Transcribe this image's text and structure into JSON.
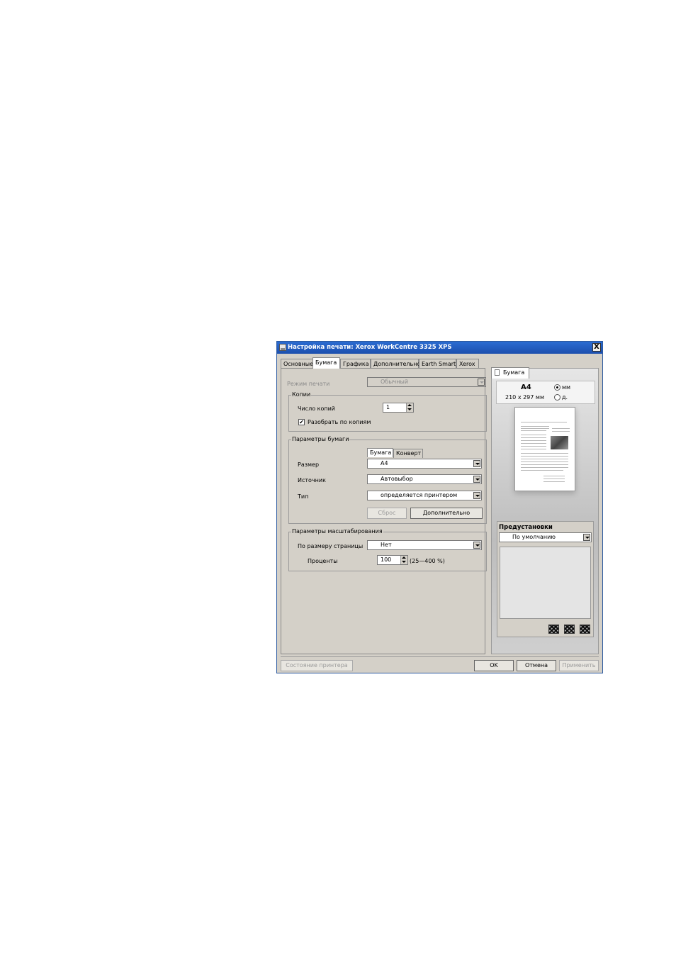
{
  "window": {
    "title": "Настройка печати: Xerox WorkCentre 3325 XPS",
    "close_label": "X"
  },
  "tabs": [
    "Основные",
    "Бумага",
    "Графика",
    "Дополнительно",
    "Earth Smart",
    "Xerox"
  ],
  "active_tab": "Бумага",
  "print_mode": {
    "label": "Режим печати",
    "value": "Обычный"
  },
  "copies": {
    "group_title": "Копии",
    "count_label": "Число копий",
    "count_value": "1",
    "collate_label": "Разобрать по копиям",
    "collate_checked": true,
    "check_mark": "✔"
  },
  "paper": {
    "group_title": "Параметры бумаги",
    "inner_tabs": [
      "Бумага",
      "Конверт"
    ],
    "size_label": "Размер",
    "size_value": "A4",
    "source_label": "Источник",
    "source_value": "Автовыбор",
    "type_label": "Тип",
    "type_value": "определяется принтером",
    "reset_button": "Сброс",
    "advanced_button": "Дополнительно"
  },
  "scaling": {
    "group_title": "Параметры масштабирования",
    "fit_label": "По размеру страницы",
    "fit_value": "Нет",
    "percent_label": "Проценты",
    "percent_value": "100",
    "range_hint": "(25—400 %)"
  },
  "preview": {
    "tab_label": "Бумага",
    "paper_name": "A4",
    "paper_dims": "210 x 297 мм",
    "unit_mm": "мм",
    "unit_in": "д."
  },
  "presets": {
    "title": "Предустановки",
    "value": "По умолчанию"
  },
  "buttons": {
    "printer_status": "Состояние принтера",
    "ok": "OK",
    "cancel": "Отмена",
    "apply": "Применить"
  }
}
